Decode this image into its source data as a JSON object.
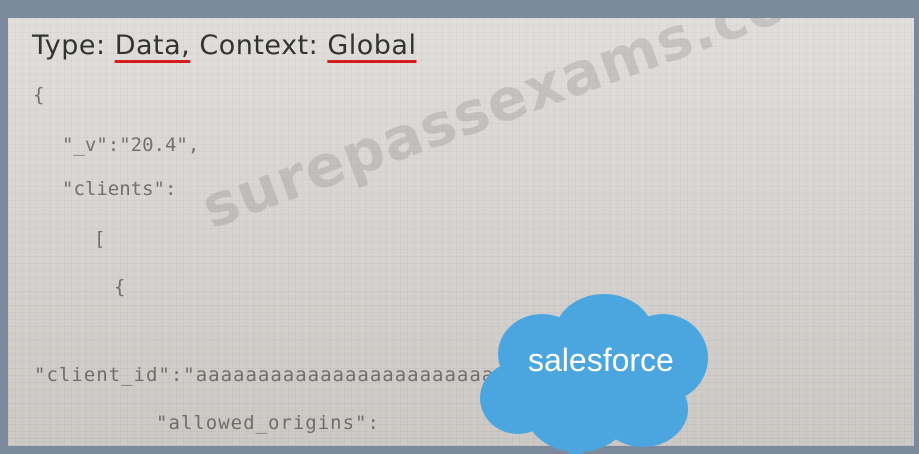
{
  "header": {
    "type_label": "Type: ",
    "type_value": "Data,",
    "context_label": "Context: ",
    "context_value": "Global"
  },
  "code_lines": [
    "{",
    "\"_v\":\"20.4\",",
    "\"clients\":",
    "[",
    "{",
    "\"client_id\":\"aaaaaaaaaaaaaaaaaaaaaaaaaaaaaaa\",",
    "\"allowed_origins\":"
  ],
  "watermark": "surepassexams.com",
  "brand": {
    "name": "salesforce",
    "color": "#4ba6e0"
  }
}
